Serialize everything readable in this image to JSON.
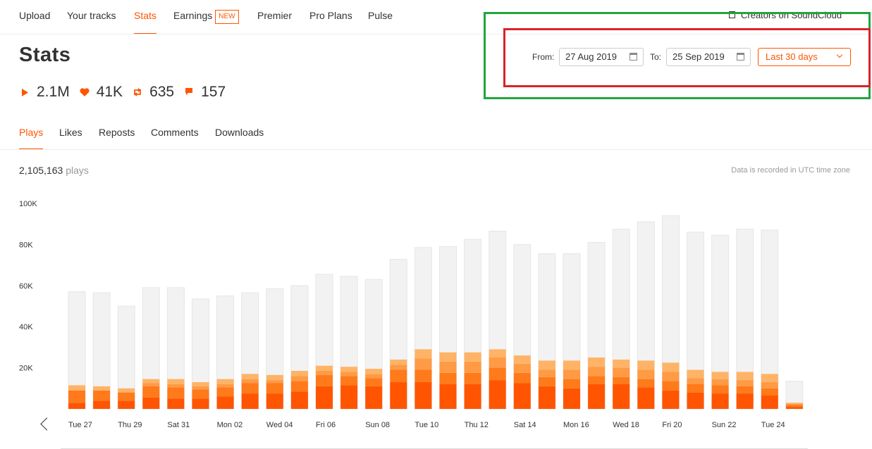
{
  "nav": {
    "items": [
      {
        "label": "Upload"
      },
      {
        "label": "Your tracks"
      },
      {
        "label": "Stats"
      },
      {
        "label": "Earnings",
        "badge": "NEW"
      },
      {
        "label": "Premier"
      },
      {
        "label": "Pro Plans"
      },
      {
        "label": "Pulse"
      }
    ],
    "creators_link": "Creators on SoundCloud"
  },
  "page_title": "Stats",
  "summary": {
    "plays": "2.1M",
    "likes": "41K",
    "reposts": "635",
    "comments": "157"
  },
  "date_range": {
    "from_label": "From:",
    "from_value": "27 Aug 2019",
    "to_label": "To:",
    "to_value": "25 Sep 2019",
    "preset": "Last 30 days"
  },
  "tabs": [
    {
      "label": "Plays"
    },
    {
      "label": "Likes"
    },
    {
      "label": "Reposts"
    },
    {
      "label": "Comments"
    },
    {
      "label": "Downloads"
    }
  ],
  "totals": {
    "count": "2,105,163",
    "unit": "plays"
  },
  "utc_note": "Data is recorded in UTC time zone",
  "colors": {
    "accent": "#ff5500",
    "bar_bg": "#f2f2f2",
    "seg1": "#ff5500",
    "seg2": "#ff7a1a",
    "seg3": "#ff9a45",
    "seg4": "#ffb366"
  },
  "chart_data": {
    "type": "bar",
    "stacked": true,
    "ylim": [
      0,
      100000
    ],
    "yticks": [
      20000,
      40000,
      60000,
      80000,
      100000
    ],
    "ytick_labels": [
      "20K",
      "40K",
      "60K",
      "80K",
      "100K"
    ],
    "categories": [
      "Tue 27",
      "Wed 28",
      "Thu 29",
      "Fri 30",
      "Sat 31",
      "Sun 01",
      "Mon 02",
      "Tue 03",
      "Wed 04",
      "Thu 05",
      "Fri 06",
      "Sat 07",
      "Sun 08",
      "Mon 09",
      "Tue 10",
      "Wed 11",
      "Thu 12",
      "Fri 13",
      "Sat 14",
      "Sun 15",
      "Mon 16",
      "Tue 17",
      "Wed 18",
      "Thu 19",
      "Fri 20",
      "Sat 21",
      "Sun 22",
      "Mon 23",
      "Tue 24",
      "Wed 25"
    ],
    "x_labels": [
      "Tue 27",
      "Thu 29",
      "Sat 31",
      "Mon 02",
      "Wed 04",
      "Fri 06",
      "Sun 08",
      "Tue 10",
      "Thu 12",
      "Sat 14",
      "Mon 16",
      "Wed 18",
      "Fri 20",
      "Sun 22",
      "Tue 24"
    ],
    "totals": [
      57000,
      56500,
      50000,
      59000,
      59000,
      53500,
      55000,
      56500,
      58500,
      60000,
      65500,
      64500,
      63000,
      72800,
      78500,
      79000,
      82500,
      86500,
      80000,
      75500,
      75500,
      81000,
      87500,
      91000,
      94000,
      86000,
      84500,
      87500,
      87000,
      13500
    ],
    "series": [
      {
        "values": [
          3000,
          4000,
          4000,
          5500,
          5000,
          5000,
          6000,
          7500,
          7500,
          8500,
          11000,
          11500,
          11000,
          13000,
          13000,
          12000,
          12000,
          14000,
          12500,
          11000,
          10000,
          12000,
          12000,
          10500,
          9000,
          8000,
          7500,
          7500,
          6500,
          1000
        ]
      },
      {
        "values": [
          6000,
          5000,
          4000,
          5500,
          5500,
          4500,
          4500,
          5000,
          5000,
          5000,
          5500,
          4500,
          4000,
          6000,
          6000,
          5500,
          5500,
          6000,
          5000,
          4500,
          4500,
          4000,
          3500,
          4000,
          4500,
          4000,
          4000,
          3500,
          3500,
          1000
        ]
      },
      {
        "values": [
          0,
          0,
          0,
          1500,
          1500,
          1500,
          1500,
          2000,
          1500,
          2500,
          2000,
          2000,
          2000,
          2500,
          5500,
          5500,
          5500,
          5000,
          4500,
          3500,
          4500,
          4500,
          4500,
          4500,
          4500,
          3000,
          3000,
          3000,
          3000,
          500
        ]
      },
      {
        "values": [
          2500,
          2000,
          2000,
          2000,
          2500,
          2000,
          2500,
          2500,
          2500,
          2500,
          2500,
          2500,
          2500,
          2500,
          4500,
          4500,
          4500,
          4000,
          4000,
          4500,
          4500,
          4500,
          4000,
          4500,
          4500,
          4000,
          3500,
          4000,
          4000,
          500
        ]
      }
    ]
  }
}
